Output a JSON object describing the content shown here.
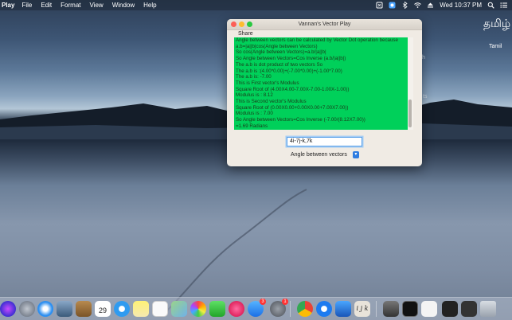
{
  "menubar": {
    "app_name": "Play",
    "items": [
      "File",
      "Edit",
      "Format",
      "View",
      "Window",
      "Help"
    ],
    "clock": "Wed 10:37 PM"
  },
  "desktop": {
    "tamil_large": "தமிழ்",
    "tamil_label": "Tamil",
    "partial_label_1": "th",
    "partial_label_2": "ts"
  },
  "window": {
    "title": "Vannan's Vector Play",
    "toolbar_share": "Share",
    "output_lines": [
      "Angle between vectors can be calculated by Vector Dot operation because",
      "a.b=|a||b|cos(Angle between Vectors)",
      "So cos(Angle between Vectors)=a.b/|a||b|",
      "So Angle between Vectors=Cos Inverse (a.b/|a||b|)",
      "The a.b is dot product of two vectors So",
      "The a.b is :(4.00*0.00)+(-7.00*0.00)+(-1.00*7.00)",
      "The  a.b is: -7.00",
      "This is First vector's Modulus",
      "Square Root of (4.00X4.00-7.00X-7.00-1.00X-1.00))",
      "Modulus is : 8.12",
      "This is Second vector's Modulus",
      "Square Root of (0.00X0.00+0.00X0.00+7.00X7.00))",
      "Modulus is : 7.00",
      "So Angle between Vectors=Cos Inverse (-7.00/(8.12X7.00))",
      "=1.69 Radians"
    ],
    "input_value": "4i-7j-k,7k",
    "operation_selected": "Angle between vectors",
    "output_bg_color": "#00d05a"
  },
  "dock": {
    "icons": [
      "siri-icon",
      "launchpad-icon",
      "safari-icon",
      "photo-preview-icon",
      "notes-book-icon",
      "calendar-icon",
      "messages-icon",
      "notes-icon",
      "reminders-icon",
      "maps-icon",
      "photos-icon",
      "facetime-icon",
      "music-icon",
      "app-store-icon",
      "system-preferences-icon",
      "chrome-icon",
      "teamviewer-icon",
      "xcode-icon",
      "vector-play-icon",
      "preview-icon",
      "terminal-icon",
      "window-thumb-icon",
      "window-thumb-icon",
      "window-thumb-icon",
      "trash-icon"
    ],
    "calendar_day": "29",
    "app_store_badge": "3",
    "sysprefs_badge": "1",
    "vector_play_label": "i j k"
  }
}
